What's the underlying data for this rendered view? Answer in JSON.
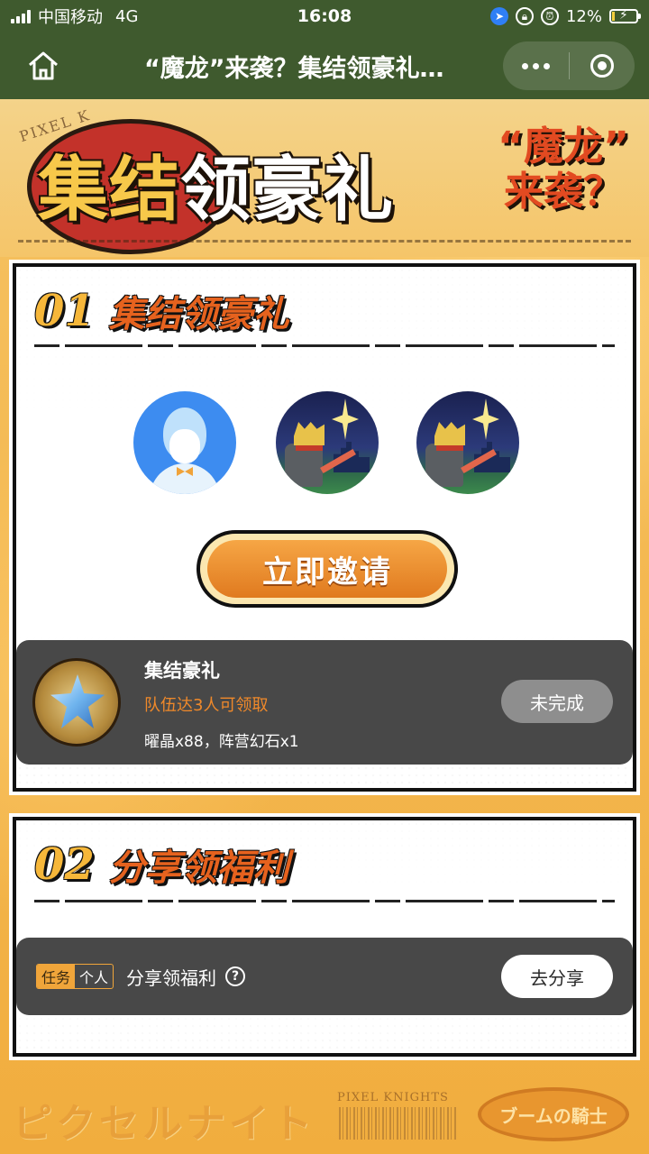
{
  "status_bar": {
    "carrier": "中国移动",
    "network": "4G",
    "time": "16:08",
    "battery": "12%"
  },
  "nav": {
    "title": "“魔龙”来袭？集结领豪礼…"
  },
  "banner": {
    "title_gold": "集结",
    "title_white": "领豪礼",
    "side_line1": "“魔龙”",
    "side_line2": "来袭？",
    "watermark": "PIXEL K"
  },
  "section1": {
    "number": "01",
    "title": "集结领豪礼",
    "invite_button": "立即邀请",
    "reward": {
      "title": "集结豪礼",
      "condition": "队伍达3人可领取",
      "items": "曜晶x88，阵营幻石x1",
      "status": "未完成"
    }
  },
  "section2": {
    "number": "02",
    "title": "分享领福利",
    "task": {
      "tag_task": "任务",
      "tag_personal": "个人",
      "name": "分享领福利",
      "help": "?",
      "button": "去分享"
    }
  },
  "footer": {
    "kana": "ピクセルナイト",
    "logo": "PIXEL KNIGHTS",
    "oval": "ブームの騎士"
  },
  "colors": {
    "nav_bg": "#3f5a2e",
    "accent_orange": "#e07a1f",
    "panel_bg": "#484848",
    "condition_text": "#f0892a"
  },
  "icons": [
    "home-icon",
    "more-icon",
    "close-capsule-icon",
    "location-icon",
    "lock-rotation-icon",
    "alarm-icon",
    "battery-icon",
    "help-icon"
  ]
}
